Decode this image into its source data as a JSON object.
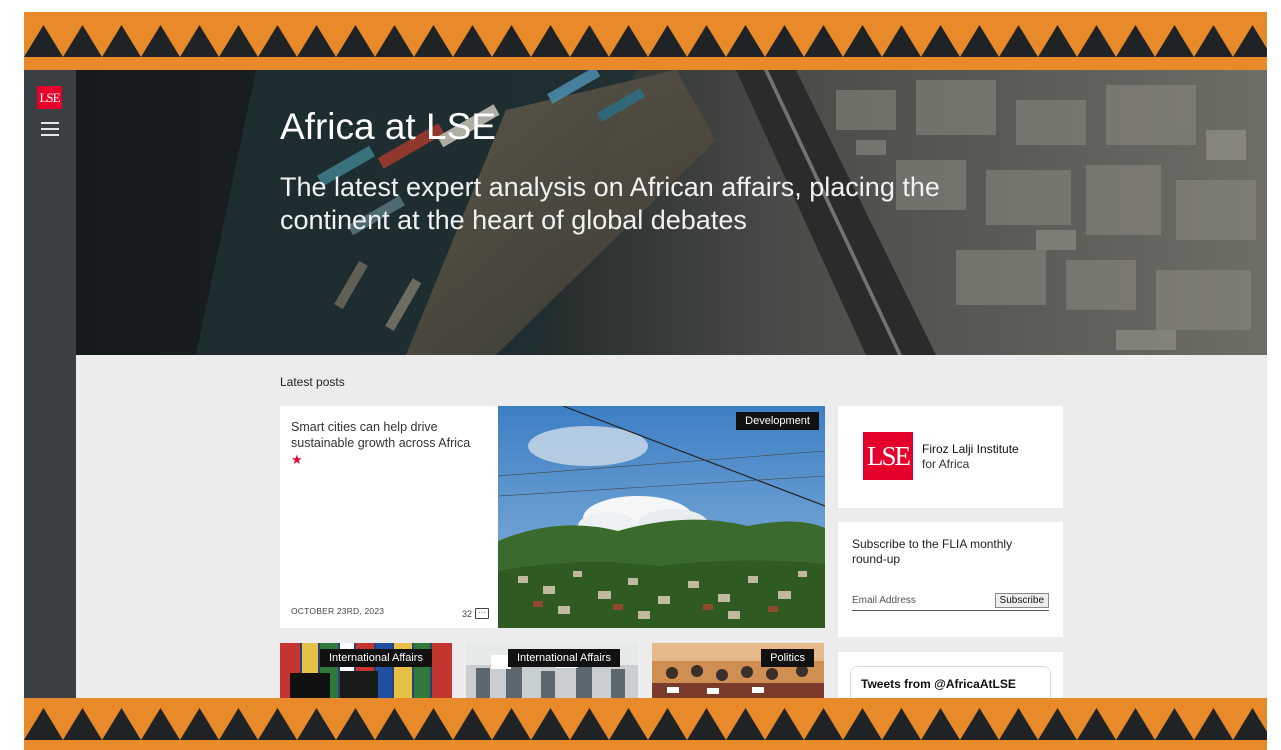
{
  "brand": {
    "logo_text": "LSE"
  },
  "nav": {
    "menu_icon": "hamburger-menu-icon"
  },
  "hero": {
    "title": "Africa at LSE",
    "subtitle": "The latest expert analysis on African affairs, placing the continent at the heart of global debates"
  },
  "latest": {
    "section_title": "Latest posts",
    "featured": {
      "headline": "Smart cities can help drive sustainable growth across Africa",
      "tag": "Development",
      "date": "OCTOBER 23RD, 2023",
      "comment_count": "32",
      "comment_icon_glyph": "···"
    },
    "thumbnails": [
      {
        "tag": "International Affairs"
      },
      {
        "tag": "International Affairs"
      },
      {
        "tag": "Politics"
      }
    ]
  },
  "sidebar_cards": {
    "flia": {
      "logo_text": "LSE",
      "name": "Firoz Lalji Institute",
      "subname": "for Africa"
    },
    "subscribe": {
      "heading": "Subscribe to the FLIA monthly round-up",
      "email_placeholder": "Email Address",
      "button_label": "Subscribe"
    },
    "tweets": {
      "title": "Tweets from @AfricaAtLSE"
    }
  },
  "colors": {
    "band_orange": "#e8892a",
    "band_dark": "#1f2326",
    "lse_red": "#e4002b",
    "sidebar_bg": "#3a3f43",
    "content_bg": "#ececec"
  }
}
